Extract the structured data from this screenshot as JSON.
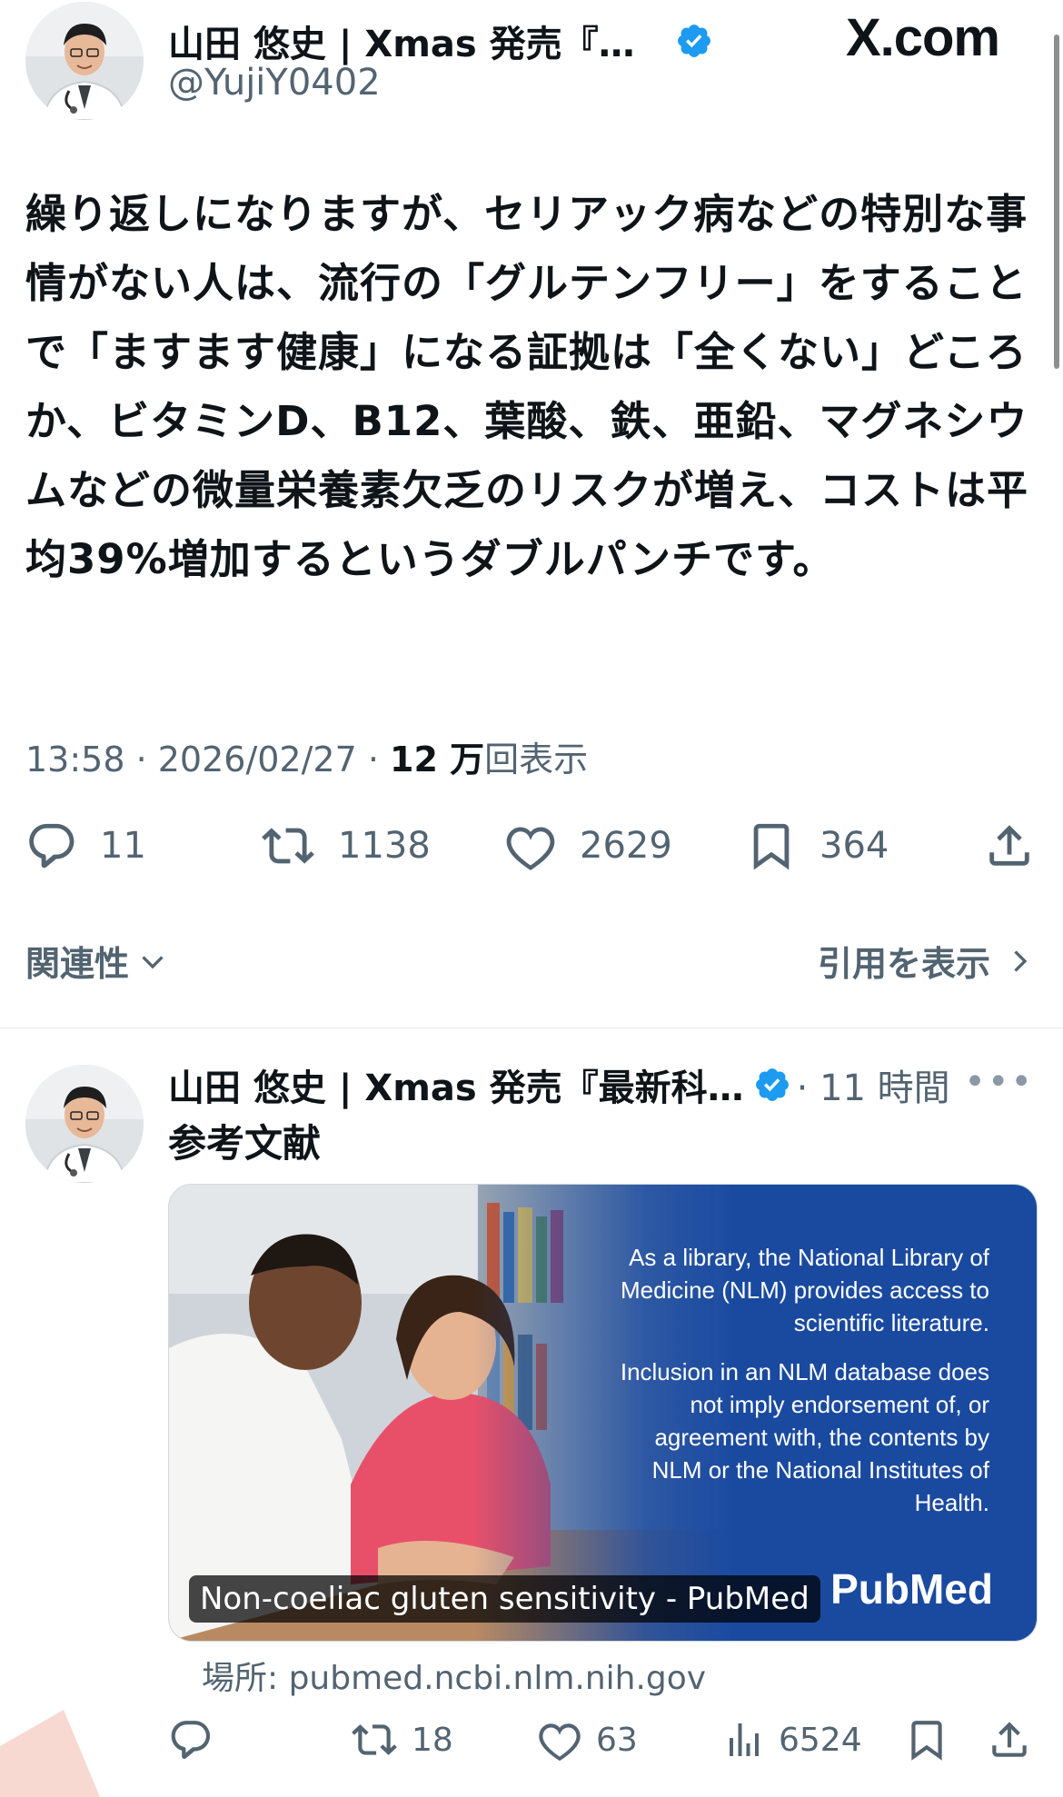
{
  "site_logo": "X.com",
  "main_tweet": {
    "display_name": "山田 悠史 | Xmas 発売『最…",
    "handle": "@YujiY0402",
    "text": "繰り返しになりますが、セリアック病などの特別な事情がない人は、流行の「グルテンフリー」をすることで「ますます健康」になる証拠は「全くない」どころか、ビタミンD、B12、葉酸、鉄、亜鉛、マグネシウムなどの微量栄養素欠乏のリスクが増え、コストは平均39%増加するというダブルパンチです。",
    "time": "13:58 · 2026/02/27 · ",
    "views_count": "12 万",
    "views_label": "回表示",
    "replies": "11",
    "retweets": "1138",
    "likes": "2629",
    "bookmarks": "364",
    "related_label": "関連性",
    "quotes_label": "引用を表示"
  },
  "reply_tweet": {
    "display_name": "山田 悠史 | Xmas 発売『最新科…",
    "time": "· 11 時間",
    "text": "参考文献",
    "card": {
      "notice_1": "As a library, the National Library of Medicine (NLM) provides access to scientific literature.",
      "notice_2": "Inclusion in an NLM database does not imply endorsement of, or agreement with, the contents by NLM or the National Institutes of Health.",
      "logo": "PubMed",
      "caption": "Non-coeliac gluten sensitivity - PubMed"
    },
    "source": "場所: pubmed.ncbi.nlm.nih.gov",
    "replies": "",
    "retweets": "18",
    "likes": "63",
    "views": "6524"
  },
  "colors": {
    "text_primary": "#0f1419",
    "text_secondary": "#536471",
    "verified_blue": "#1d9bf0",
    "card_blue": "#1a4aa0"
  },
  "icons": [
    "reply-icon",
    "retweet-icon",
    "like-icon",
    "bookmark-icon",
    "share-icon",
    "views-icon",
    "verified-icon",
    "chevron-down-icon",
    "chevron-right-icon",
    "more-icon"
  ]
}
